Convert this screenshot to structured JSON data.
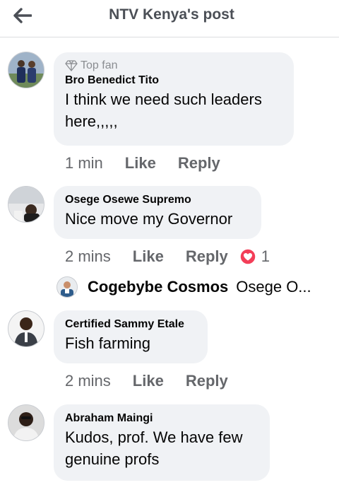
{
  "header": {
    "title": "NTV Kenya's post"
  },
  "comments": [
    {
      "badge": "Top fan",
      "author": "Bro Benedict Tito",
      "text": "I think we need such leaders here,,,,,",
      "time": "1 min",
      "like": "Like",
      "reply": "Reply"
    },
    {
      "author": "Osege Osewe Supremo",
      "text": "Nice move my Governor",
      "time": "2 mins",
      "like": "Like",
      "reply": "Reply",
      "reaction_count": "1"
    },
    {
      "author": "Certified Sammy Etale",
      "text": "Fish farming",
      "time": "2 mins",
      "like": "Like",
      "reply": "Reply"
    },
    {
      "author": "Abraham Maingi",
      "text": "Kudos, prof. We have few genuine profs"
    }
  ],
  "reply_preview": {
    "author": "Cogebybe Cosmos",
    "snippet": "Osege O..."
  },
  "icons": {
    "back": "arrow-left-icon",
    "badge": "diamond-icon",
    "reaction": "love-reaction-icon"
  },
  "colors": {
    "bubble": "#f0f2f5",
    "meta_text": "#65676b",
    "love": "#f33e58"
  }
}
